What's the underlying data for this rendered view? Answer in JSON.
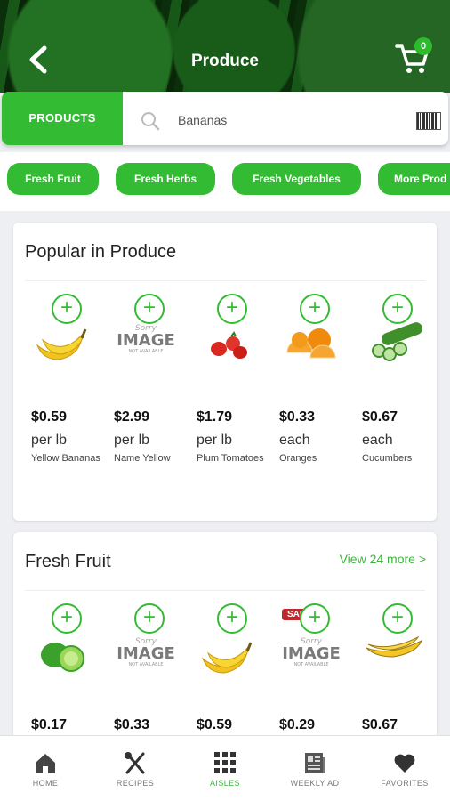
{
  "header": {
    "title": "Produce",
    "cart_count": "0"
  },
  "search": {
    "tab_label": "PRODUCTS",
    "value": "Bananas"
  },
  "chips": [
    "Fresh Fruit",
    "Fresh Herbs",
    "Fresh Vegetables",
    "More Prod"
  ],
  "popular": {
    "title": "Popular in Produce",
    "products": [
      {
        "price": "$0.59",
        "unit": "per lb",
        "name": "Yellow Bananas",
        "image": "banana"
      },
      {
        "price": "$2.99",
        "unit": "per lb",
        "name": "Name Yellow",
        "image": "image-not-available"
      },
      {
        "price": "$1.79",
        "unit": "per lb",
        "name": "Plum Tomatoes",
        "image": "tomato"
      },
      {
        "price": "$0.33",
        "unit": "each",
        "name": "Oranges",
        "image": "orange"
      },
      {
        "price": "$0.67",
        "unit": "each",
        "name": "Cucumbers",
        "image": "cucumber"
      }
    ]
  },
  "fresh_fruit": {
    "title": "Fresh Fruit",
    "view_more": "View 24 more >",
    "products": [
      {
        "price": "$0.17",
        "image": "lime"
      },
      {
        "price": "$0.33",
        "image": "image-not-available"
      },
      {
        "price": "$0.59",
        "image": "banana"
      },
      {
        "price": "$0.29",
        "image": "image-not-available",
        "sale_tag": "SALE"
      },
      {
        "price": "$0.67",
        "image": "plantain"
      }
    ]
  },
  "na_text": {
    "line1": "Sorry",
    "line2": "IMAGE",
    "line3": "NOT AVAILABLE"
  },
  "bottom_nav": [
    {
      "label": "HOME",
      "icon": "home-icon"
    },
    {
      "label": "RECIPES",
      "icon": "recipes-icon"
    },
    {
      "label": "AISLES",
      "icon": "aisles-icon",
      "active": true
    },
    {
      "label": "WEEKLY AD",
      "icon": "weekly-ad-icon"
    },
    {
      "label": "FAVORITES",
      "icon": "heart-icon"
    }
  ],
  "colors": {
    "brand_green": "#33bb33",
    "link_green": "#3db53d"
  }
}
